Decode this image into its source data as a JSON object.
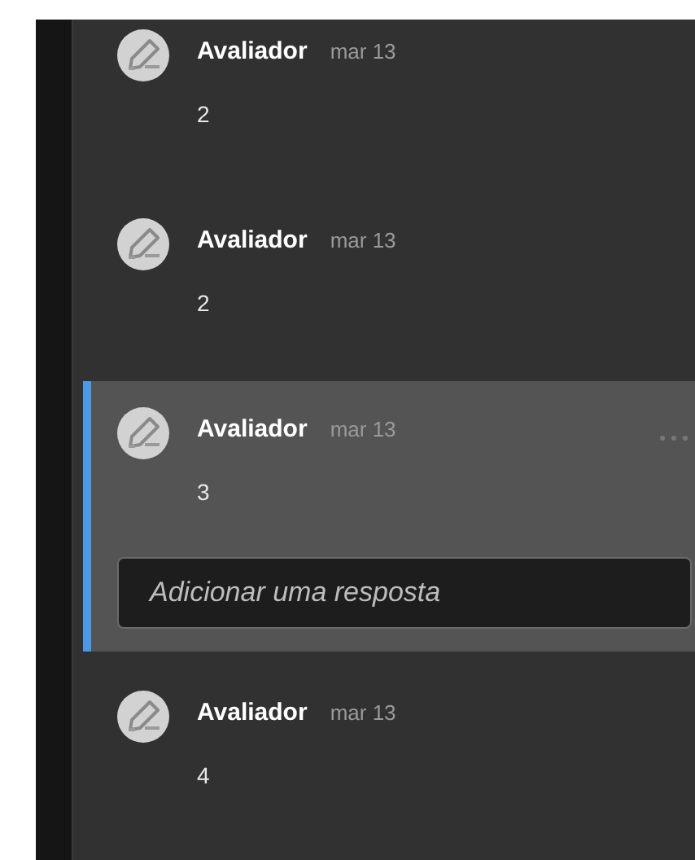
{
  "comments": [
    {
      "author": "Avaliador",
      "date": "mar 13",
      "body": "2",
      "selected": false
    },
    {
      "author": "Avaliador",
      "date": "mar 13",
      "body": "2",
      "selected": false
    },
    {
      "author": "Avaliador",
      "date": "mar 13",
      "body": "3",
      "selected": true
    },
    {
      "author": "Avaliador",
      "date": "mar 13",
      "body": "4",
      "selected": false
    }
  ],
  "reply": {
    "placeholder": "Adicionar uma resposta"
  }
}
